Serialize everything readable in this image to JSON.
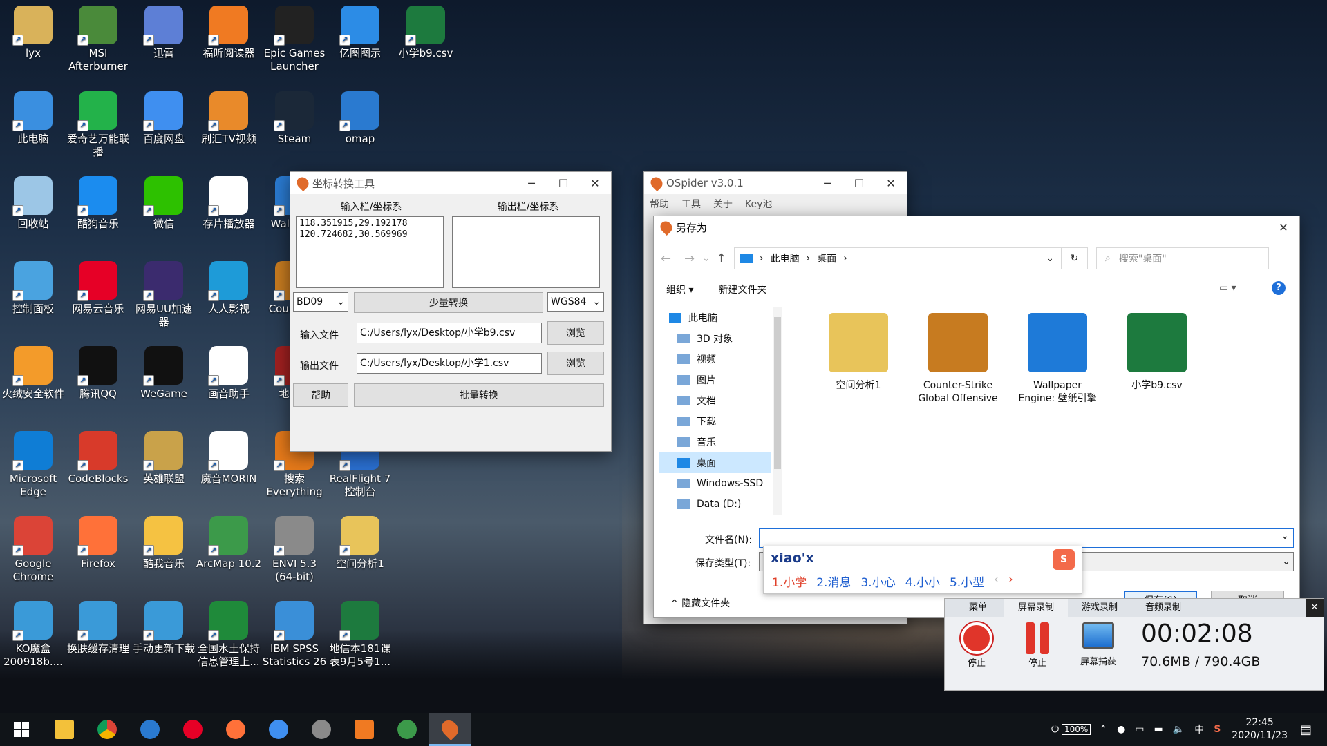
{
  "desktop_icons": [
    {
      "label": "lyx",
      "color": "#d9b25a"
    },
    {
      "label": "MSI Afterburner",
      "color": "#4a8a3a"
    },
    {
      "label": "迅雷",
      "color": "#5d7fd6"
    },
    {
      "label": "福昕阅读器",
      "color": "#f07a22"
    },
    {
      "label": "Epic Games Launcher",
      "color": "#222222"
    },
    {
      "label": "亿图图示",
      "color": "#2c8ce6"
    },
    {
      "label": "小学b9.csv",
      "color": "#1d7a3e"
    },
    {
      "label": "此电脑",
      "color": "#3a8fe0"
    },
    {
      "label": "爱奇艺万能联播",
      "color": "#23b24a"
    },
    {
      "label": "百度网盘",
      "color": "#3f8ff0"
    },
    {
      "label": "刷汇TV视频",
      "color": "#e98a2a"
    },
    {
      "label": "Steam",
      "color": "#1b2838"
    },
    {
      "label": "omap",
      "color": "#2a7ad0"
    },
    {
      "label": "回收站",
      "color": "#9cc6e6"
    },
    {
      "label": "酷狗音乐",
      "color": "#1b8cef"
    },
    {
      "label": "微信",
      "color": "#2dc100"
    },
    {
      "label": "存片播放器",
      "color": "#ffffff"
    },
    {
      "label": "Wall Engi",
      "color": "#2a7ad0"
    },
    {
      "label": "控制面板",
      "color": "#4aa3e0"
    },
    {
      "label": "网易云音乐",
      "color": "#e60026"
    },
    {
      "label": "网易UU加速器",
      "color": "#3b2b6e"
    },
    {
      "label": "人人影视",
      "color": "#1e9bd8"
    },
    {
      "label": "Cour Glob",
      "color": "#c77b20"
    },
    {
      "label": "火绒安全软件",
      "color": "#f39b2a"
    },
    {
      "label": "腾讯QQ",
      "color": "#111111"
    },
    {
      "label": "WeGame",
      "color": "#111111"
    },
    {
      "label": "画音助手",
      "color": "#ffffff"
    },
    {
      "label": "地下城",
      "color": "#a02020"
    },
    {
      "label": "Microsoft Edge",
      "color": "#0f7dd5"
    },
    {
      "label": "CodeBlocks",
      "color": "#d83a2a"
    },
    {
      "label": "英雄联盟",
      "color": "#c9a24a"
    },
    {
      "label": "魔音MORIN",
      "color": "#ffffff"
    },
    {
      "label": "搜索 Everything",
      "color": "#e67a1a"
    },
    {
      "label": "RealFlight 7 控制台",
      "color": "#2a6fd0"
    },
    {
      "label": "Google Chrome",
      "color": "#db4437"
    },
    {
      "label": "Firefox",
      "color": "#ff7139"
    },
    {
      "label": "酷我音乐",
      "color": "#f5c242"
    },
    {
      "label": "ArcMap 10.2",
      "color": "#3c9a4a"
    },
    {
      "label": "ENVI 5.3 (64-bit)",
      "color": "#8a8a8a"
    },
    {
      "label": "空间分析1",
      "color": "#e8c45a"
    },
    {
      "label": "KO魔盒 200918b....",
      "color": "#3a9ad8"
    },
    {
      "label": "换肤缓存清理",
      "color": "#3a9ad8"
    },
    {
      "label": "手动更新下载",
      "color": "#3a9ad8"
    },
    {
      "label": "全国水土保持信息管理上...",
      "color": "#1f8a3a"
    },
    {
      "label": "IBM SPSS Statistics 26",
      "color": "#3a8fd8"
    },
    {
      "label": "地信本181课表9月5号1...",
      "color": "#1d7a3e"
    }
  ],
  "coord_tool": {
    "title": "坐标转换工具",
    "input_header": "输入栏/坐标系",
    "output_header": "输出栏/坐标系",
    "input_lines": [
      "118.351915,29.192178",
      "120.724682,30.569969"
    ],
    "output_text": "",
    "input_crs": "BD09",
    "output_crs": "WGS84",
    "small_convert": "少量转换",
    "input_file_label": "输入文件",
    "input_file_value": "C:/Users/lyx/Desktop/小学b9.csv",
    "output_file_label": "输出文件",
    "output_file_value": "C:/Users/lyx/Desktop/小学1.csv",
    "browse": "浏览",
    "help": "帮助",
    "batch_convert": "批量转换"
  },
  "ospider": {
    "title": "OSpider v3.0.1",
    "menu": [
      "帮助",
      "工具",
      "关于",
      "Key池"
    ]
  },
  "save_dialog": {
    "title": "另存为",
    "breadcrumb": [
      "此电脑",
      "桌面"
    ],
    "search_placeholder": "搜索\"桌面\"",
    "organize": "组织",
    "new_folder": "新建文件夹",
    "tree": [
      "此电脑",
      "3D 对象",
      "视频",
      "图片",
      "文档",
      "下载",
      "音乐",
      "桌面",
      "Windows-SSD",
      "Data (D:)"
    ],
    "files": [
      {
        "name": "空间分析1",
        "color": "#e8c45a"
      },
      {
        "name": "Counter-Strike Global Offensive",
        "color": "#c77b20"
      },
      {
        "name": "Wallpaper Engine: 壁纸引擎",
        "color": "#1e7ad8"
      },
      {
        "name": "小学b9.csv",
        "color": "#1d7a3e"
      }
    ],
    "filename_label": "文件名(N):",
    "filename_value": "",
    "filetype_label": "保存类型(T):",
    "hide_folders": "隐藏文件夹",
    "save": "保存(S)",
    "cancel": "取消"
  },
  "ime": {
    "composition": "xiao'x",
    "candidates": [
      "1.小学",
      "2.消息",
      "3.小心",
      "4.小小",
      "5.小型"
    ]
  },
  "recorder": {
    "tabs": [
      "菜单",
      "屏幕录制",
      "游戏录制",
      "音频录制"
    ],
    "stop1": "停止",
    "stop2": "停止",
    "capture": "屏幕捕获",
    "time": "00:02:08",
    "size": "70.6MB / 790.4GB"
  },
  "tray": {
    "battery": "100%",
    "ime_lang": "中",
    "time": "22:45",
    "date": "2020/11/23"
  }
}
